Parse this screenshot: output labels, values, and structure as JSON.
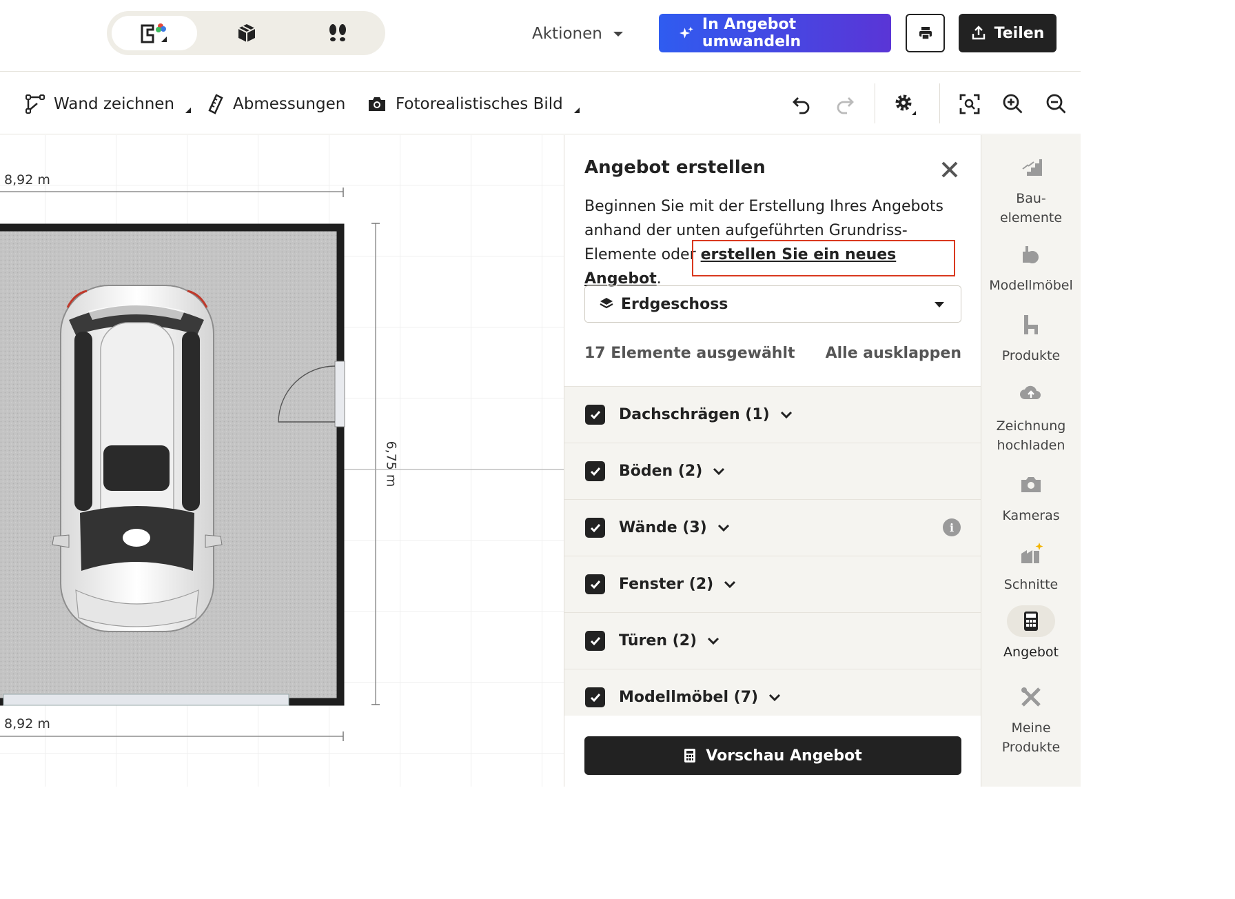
{
  "topbar": {
    "view_modes": [
      "2d-plan",
      "3d-view",
      "walkthrough"
    ],
    "active_view": "2d-plan",
    "actions_label": "Aktionen",
    "convert_label": "In Angebot umwandeln",
    "share_label": "Teilen",
    "colors": {
      "convert_start": "#2f5cf0",
      "convert_end": "#5a35d6",
      "dark": "#222222"
    }
  },
  "toolbar": {
    "draw_wall_label": "Wand zeichnen",
    "dimensions_label": "Abmessungen",
    "photo_label": "Fotorealistisches Bild"
  },
  "canvas": {
    "dim_top": "8,92 m",
    "dim_bottom": "8,92 m",
    "dim_right": "6,75 m"
  },
  "panel": {
    "title": "Angebot erstellen",
    "desc_prefix": "Beginnen Sie mit der Erstellung Ihres Angebots anhand der unten aufgeführten Grundriss-Elemente oder ",
    "desc_link": "erstellen Sie ein neues Angebot",
    "desc_suffix": ".",
    "floor_select": "Erdgeschoss",
    "selected_count": "17 Elemente ausgewählt",
    "expand_all": "Alle ausklappen",
    "groups": [
      {
        "label": "Dachschrägen (1)",
        "checked": true,
        "info": false
      },
      {
        "label": "Böden (2)",
        "checked": true,
        "info": false
      },
      {
        "label": "Wände (3)",
        "checked": true,
        "info": true
      },
      {
        "label": "Fenster (2)",
        "checked": true,
        "info": false
      },
      {
        "label": "Türen (2)",
        "checked": true,
        "info": false
      },
      {
        "label": "Modellmöbel (7)",
        "checked": true,
        "info": false
      }
    ],
    "preview_label": "Vorschau Angebot",
    "highlight_color": "#d9381e"
  },
  "sidebar": {
    "items": [
      {
        "label": "Bau-\nelemente",
        "icon": "stairs-icon"
      },
      {
        "label": "Modellmöbel",
        "icon": "furniture-icon"
      },
      {
        "label": "Produkte",
        "icon": "chair-icon"
      },
      {
        "label": "Zeichnung\nhochladen",
        "icon": "cloud-upload-icon"
      },
      {
        "label": "Kameras",
        "icon": "camera-icon"
      },
      {
        "label": "Schnitte",
        "icon": "building-sparkle-icon"
      },
      {
        "label": "Angebot",
        "icon": "calculator-icon"
      },
      {
        "label": "Meine\nProdukte",
        "icon": "tools-icon"
      }
    ],
    "active": "Angebot"
  }
}
